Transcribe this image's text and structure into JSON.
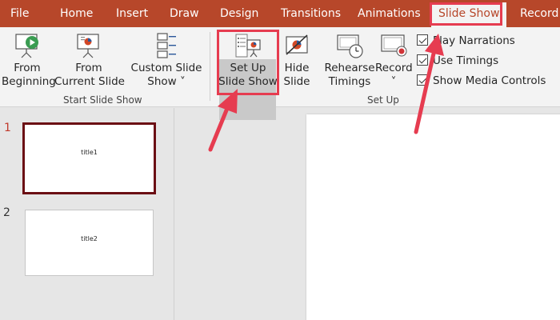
{
  "tabs": [
    "File",
    "Home",
    "Insert",
    "Draw",
    "Design",
    "Transitions",
    "Animations",
    "Slide Show",
    "Record"
  ],
  "active_tab": "Slide Show",
  "ribbon": {
    "start_group": {
      "label": "Start Slide Show",
      "from_beginning": [
        "From",
        "Beginning"
      ],
      "from_current": [
        "From",
        "Current Slide"
      ],
      "custom": [
        "Custom Slide",
        "Show ˅"
      ]
    },
    "setup_group": {
      "label": "Set Up",
      "setup_show": [
        "Set Up",
        "Slide Show"
      ],
      "hide_slide": [
        "Hide",
        "Slide"
      ],
      "rehearse": [
        "Rehearse",
        "Timings"
      ],
      "record": [
        "Record",
        "˅"
      ]
    },
    "checkboxes": [
      {
        "label": "Play Narrations",
        "checked": true
      },
      {
        "label": "Use Timings",
        "checked": true
      },
      {
        "label": "Show Media Controls",
        "checked": true
      }
    ]
  },
  "slides": [
    {
      "number": "1",
      "title": "title1",
      "selected": true
    },
    {
      "number": "2",
      "title": "title2",
      "selected": false
    }
  ],
  "colors": {
    "accent": "#b7472a",
    "highlight": "#e63c50",
    "selected_thumb": "#6b0f14"
  }
}
